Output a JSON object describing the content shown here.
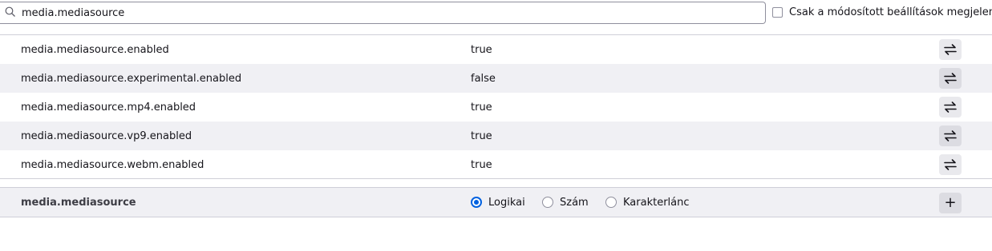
{
  "search": {
    "value": "media.mediasource",
    "placeholder": ""
  },
  "filter": {
    "modified_only_label": "Csak a módosított beállítások megjelenítése",
    "checked": false
  },
  "prefs": [
    {
      "name": "media.mediasource.enabled",
      "value": "true"
    },
    {
      "name": "media.mediasource.experimental.enabled",
      "value": "false"
    },
    {
      "name": "media.mediasource.mp4.enabled",
      "value": "true"
    },
    {
      "name": "media.mediasource.vp9.enabled",
      "value": "true"
    },
    {
      "name": "media.mediasource.webm.enabled",
      "value": "true"
    }
  ],
  "new_pref": {
    "name": "media.mediasource",
    "types": [
      "Logikai",
      "Szám",
      "Karakterlánc"
    ],
    "selected": "Logikai",
    "add_label": "+"
  },
  "icons": {
    "search": "search-icon",
    "toggle": "toggle-icon",
    "add": "plus-icon"
  },
  "colors": {
    "accent": "#0061e0",
    "row_alt": "#f0f0f4",
    "button": "#e9e9ed"
  }
}
